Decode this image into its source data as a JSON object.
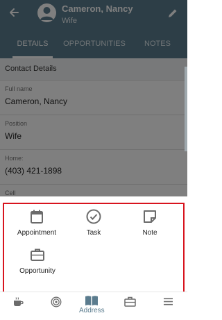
{
  "header": {
    "name": "Cameron, Nancy",
    "relation": "Wife",
    "back_icon": "arrow-left-icon",
    "edit_icon": "pencil-icon"
  },
  "tabs": [
    {
      "label": "DETAILS",
      "active": true
    },
    {
      "label": "OPPORTUNITIES",
      "active": false
    },
    {
      "label": "NOTES",
      "active": false
    }
  ],
  "details": {
    "section_title": "Contact Details",
    "fields": [
      {
        "label": "Full name",
        "value": "Cameron, Nancy"
      },
      {
        "label": "Position",
        "value": "Wife"
      },
      {
        "label": "Home:",
        "value": "(403) 421-1898"
      },
      {
        "label": "Cell",
        "value": ""
      }
    ]
  },
  "actions": [
    {
      "label": "Appointment",
      "icon": "calendar-icon"
    },
    {
      "label": "Task",
      "icon": "check-circle-icon"
    },
    {
      "label": "Note",
      "icon": "note-icon"
    },
    {
      "label": "Opportunity",
      "icon": "briefcase-icon"
    }
  ],
  "bottom_nav": {
    "items": [
      {
        "icon": "coffee-icon",
        "label": ""
      },
      {
        "icon": "target-icon",
        "label": ""
      },
      {
        "icon": "book-icon",
        "label": "Address"
      },
      {
        "icon": "briefcase-icon",
        "label": ""
      },
      {
        "icon": "menu-icon",
        "label": ""
      }
    ]
  },
  "colors": {
    "header": "#5b7c8e",
    "highlight_frame": "#d8141e",
    "icon": "#6b6b6b",
    "nav_active": "#5b7c8e"
  }
}
